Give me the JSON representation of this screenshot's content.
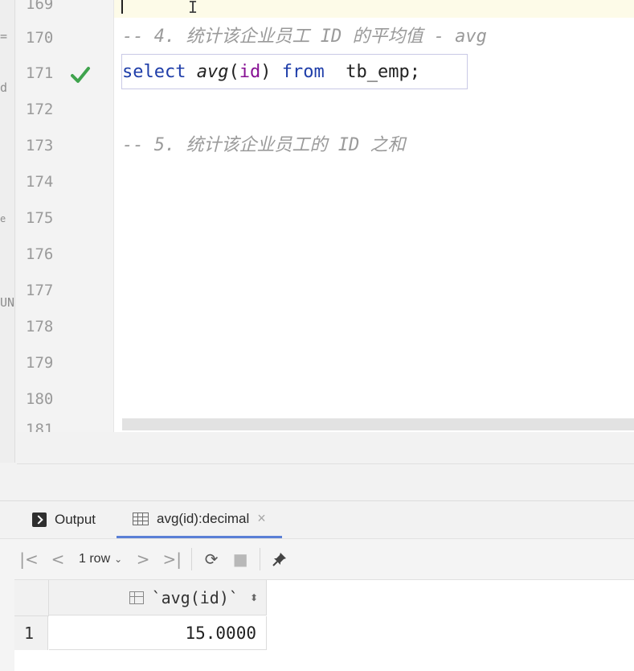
{
  "left_strip": {
    "fragments": [
      "=",
      "d",
      "e",
      "UN"
    ]
  },
  "editor": {
    "line_numbers": [
      "169",
      "170",
      "171",
      "172",
      "173",
      "174",
      "175",
      "176",
      "177",
      "178",
      "179",
      "180",
      "181"
    ],
    "lines": {
      "l170": "-- 4. 统计该企业员工 ID 的平均值 - avg",
      "l171": {
        "kw_select": "select",
        "fn_avg": "avg",
        "paren_open": "(",
        "field_id": "id",
        "paren_close": ")",
        "kw_from": "from",
        "table": "tb_emp;"
      },
      "l173": "-- 5. 统计该企业员工的 ID 之和"
    },
    "cursor_glyph": "I",
    "run_status_icon": "checkmark-green"
  },
  "results_panel": {
    "tabs": [
      {
        "label": "Output",
        "icon": "terminal-icon"
      },
      {
        "label": "avg(id):decimal",
        "icon": "table-icon",
        "close": "×"
      }
    ],
    "toolbar": {
      "first": "|<",
      "prev": "<",
      "rows_label": "1 row",
      "rows_chevron": "⌄",
      "next": ">",
      "last": ">|",
      "refresh": "⟳",
      "stop": "■",
      "pin": "📌"
    },
    "grid": {
      "column_header": "`avg(id)`",
      "sort_symbol": "⬍",
      "rows": [
        {
          "num": "1",
          "value": "15.0000"
        }
      ]
    }
  },
  "colors": {
    "keyword": "#1f3ea9",
    "field": "#871094",
    "comment": "#9a9a9a",
    "check": "#3fa34d",
    "tab_underline": "#5a7fd6"
  }
}
